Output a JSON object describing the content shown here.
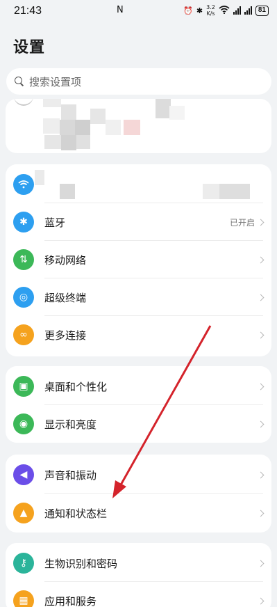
{
  "status_bar": {
    "time": "21:43",
    "nfc": "N",
    "net_speed_top": "3.2",
    "net_speed_bottom": "K/s",
    "battery": "81"
  },
  "header": {
    "title": "设置"
  },
  "search": {
    "placeholder": "搜索设置项"
  },
  "connections": [
    {
      "label": "",
      "value": "",
      "icon": "wifi-icon",
      "color": "#2d9ff0"
    },
    {
      "label": "蓝牙",
      "value": "已开启",
      "icon": "bluetooth-icon",
      "color": "#2d9ff0"
    },
    {
      "label": "移动网络",
      "value": "",
      "icon": "mobile-data-icon",
      "color": "#3cb858"
    },
    {
      "label": "超级终端",
      "value": "",
      "icon": "super-device-icon",
      "color": "#2d9ff0"
    },
    {
      "label": "更多连接",
      "value": "",
      "icon": "link-icon",
      "color": "#f5a21e"
    }
  ],
  "display": [
    {
      "label": "桌面和个性化",
      "icon": "image-icon",
      "color": "#3cb858"
    },
    {
      "label": "显示和亮度",
      "icon": "eye-icon",
      "color": "#3cb858"
    }
  ],
  "sound": [
    {
      "label": "声音和振动",
      "icon": "volume-icon",
      "color": "#6b4ee8"
    },
    {
      "label": "通知和状态栏",
      "icon": "bell-icon",
      "color": "#f5a21e"
    }
  ],
  "security": [
    {
      "label": "生物识别和密码",
      "icon": "key-icon",
      "color": "#2bb49a"
    },
    {
      "label": "应用和服务",
      "icon": "apps-icon",
      "color": "#f5a21e"
    }
  ],
  "colors": {
    "background": "#f1f3f5",
    "card": "#ffffff",
    "annotation_arrow": "#d4232b"
  }
}
